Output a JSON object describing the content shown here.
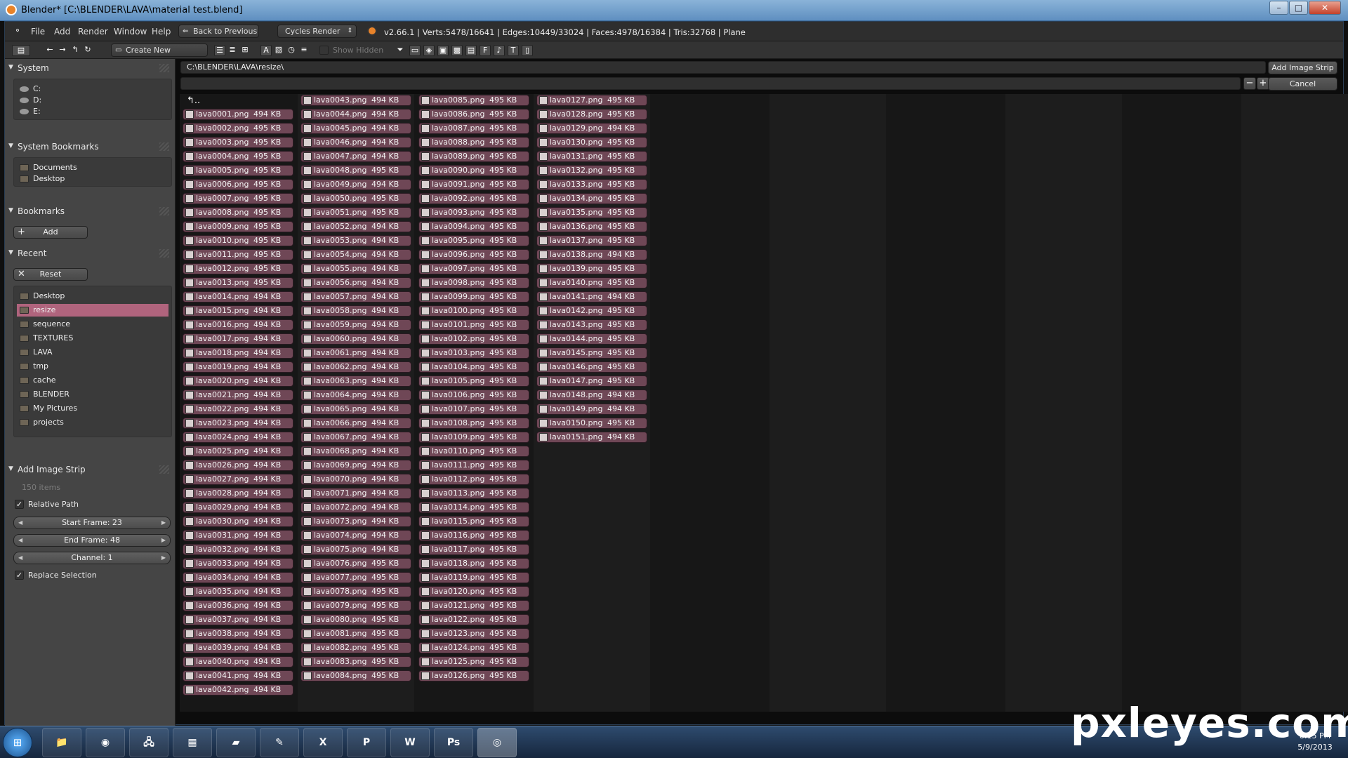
{
  "window": {
    "title": "Blender* [C:\\BLENDER\\LAVA\\material test.blend]",
    "min_glyph": "–",
    "max_glyph": "□",
    "close_glyph": "✕"
  },
  "menu": {
    "file": "File",
    "add": "Add",
    "render": "Render",
    "window": "Window",
    "help": "Help",
    "back_to_previous": "Back to Previous",
    "render_engine": "Cycles Render",
    "stats": "v2.66.1 | Verts:5478/16641 | Edges:10449/33024 | Faces:4978/16384 | Tris:32768 | Plane"
  },
  "toolbar": {
    "create_new_directory": "Create New Directory",
    "show_hidden": "Show Hidden"
  },
  "left_panel": {
    "system": {
      "title": "System",
      "items": [
        "C:",
        "D:",
        "E:"
      ]
    },
    "system_bookmarks": {
      "title": "System Bookmarks",
      "items": [
        "Documents",
        "Desktop"
      ]
    },
    "bookmarks": {
      "title": "Bookmarks",
      "add_label": "Add"
    },
    "recent": {
      "title": "Recent",
      "reset_label": "Reset",
      "items": [
        "Desktop",
        "resize",
        "sequence",
        "TEXTURES",
        "LAVA",
        "tmp",
        "cache",
        "BLENDER",
        "My Pictures",
        "projects"
      ],
      "active": "resize"
    },
    "add_image_strip": {
      "title": "Add Image Strip",
      "items_count": "150 items",
      "relative_path": "Relative Path",
      "start_frame": "Start Frame: 23",
      "end_frame": "End Frame: 48",
      "channel": "Channel: 1",
      "replace_selection": "Replace Selection"
    }
  },
  "browser": {
    "path": "C:\\BLENDER\\LAVA\\resize\\",
    "filter_value": "",
    "add_image_strip_button": "Add Image Strip",
    "cancel_button": "Cancel",
    "parent_dir": "..",
    "file_sizes": [
      "494 KB",
      "495 KB",
      "495 KB",
      "495 KB",
      "495 KB",
      "495 KB",
      "495 KB",
      "495 KB",
      "495 KB",
      "495 KB",
      "495 KB",
      "495 KB",
      "495 KB",
      "494 KB",
      "494 KB",
      "494 KB",
      "494 KB",
      "494 KB",
      "494 KB",
      "494 KB",
      "494 KB",
      "494 KB",
      "494 KB",
      "494 KB",
      "494 KB",
      "494 KB",
      "494 KB",
      "494 KB",
      "494 KB",
      "494 KB",
      "494 KB",
      "494 KB",
      "494 KB",
      "494 KB",
      "494 KB",
      "494 KB",
      "494 KB",
      "494 KB",
      "494 KB",
      "494 KB",
      "494 KB",
      "494 KB",
      "494 KB",
      "494 KB",
      "494 KB",
      "494 KB",
      "494 KB",
      "495 KB",
      "494 KB",
      "495 KB",
      "495 KB",
      "494 KB",
      "494 KB",
      "494 KB",
      "494 KB",
      "494 KB",
      "494 KB",
      "494 KB",
      "494 KB",
      "494 KB",
      "494 KB",
      "494 KB",
      "494 KB",
      "494 KB",
      "494 KB",
      "494 KB",
      "494 KB",
      "494 KB",
      "494 KB",
      "494 KB",
      "494 KB",
      "494 KB",
      "494 KB",
      "494 KB",
      "494 KB",
      "495 KB",
      "495 KB",
      "495 KB",
      "495 KB",
      "495 KB",
      "495 KB",
      "495 KB",
      "495 KB",
      "495 KB",
      "495 KB",
      "495 KB",
      "495 KB",
      "495 KB",
      "495 KB",
      "495 KB",
      "495 KB",
      "495 KB",
      "495 KB",
      "495 KB",
      "495 KB",
      "495 KB",
      "495 KB",
      "495 KB",
      "495 KB",
      "495 KB",
      "495 KB",
      "495 KB",
      "495 KB",
      "495 KB",
      "495 KB",
      "495 KB",
      "495 KB",
      "495 KB",
      "495 KB",
      "495 KB",
      "495 KB",
      "495 KB",
      "495 KB",
      "495 KB",
      "495 KB",
      "495 KB",
      "495 KB",
      "495 KB",
      "495 KB",
      "495 KB",
      "495 KB",
      "495 KB",
      "495 KB",
      "495 KB",
      "495 KB",
      "495 KB",
      "495 KB",
      "495 KB",
      "494 KB",
      "495 KB",
      "495 KB",
      "495 KB",
      "495 KB",
      "495 KB",
      "495 KB",
      "495 KB",
      "495 KB",
      "494 KB",
      "495 KB",
      "495 KB",
      "494 KB",
      "495 KB",
      "495 KB",
      "495 KB",
      "495 KB",
      "495 KB",
      "495 KB",
      "494 KB",
      "494 KB",
      "495 KB",
      "494 KB"
    ]
  },
  "taskbar": {
    "start_glyph": "⊞",
    "apps": [
      {
        "name": "explorer",
        "glyph": "📁"
      },
      {
        "name": "firefox",
        "glyph": "◉"
      },
      {
        "name": "network",
        "glyph": "🖧"
      },
      {
        "name": "calculator",
        "glyph": "▦"
      },
      {
        "name": "usb",
        "glyph": "▰"
      },
      {
        "name": "notepad",
        "glyph": "✎"
      },
      {
        "name": "excel",
        "glyph": "X"
      },
      {
        "name": "powerpoint",
        "glyph": "P"
      },
      {
        "name": "word",
        "glyph": "W"
      },
      {
        "name": "photoshop",
        "glyph": "Ps"
      },
      {
        "name": "blender",
        "glyph": "◎"
      }
    ],
    "time": "8:15 PM",
    "date": "5/9/2013"
  },
  "watermark": "pxleyes.com",
  "colors": {
    "file_row": "#6f4756",
    "active_item": "#b0647d",
    "panel_bg": "#454545",
    "header_bg": "#2e2e2e"
  }
}
